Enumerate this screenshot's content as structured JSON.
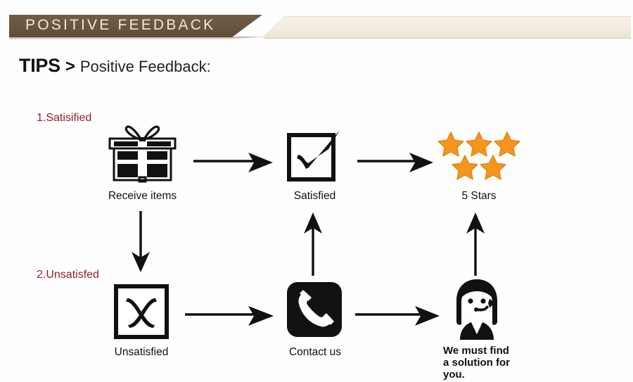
{
  "banner": {
    "title": "POSITIVE  FEEDBACK",
    "dark_color": "#6b573f",
    "light_color": "#f3ece0",
    "text_color": "#f3e7d2"
  },
  "tips": {
    "keyword": "TIPS",
    "separator": ">",
    "text": "Positive Feedback:"
  },
  "flow": {
    "label_color": "#8f1f2a",
    "star_color": "#f7941e",
    "steps": [
      {
        "number": "1.Satisified"
      },
      {
        "number": "2.Unsatisfed"
      }
    ],
    "nodes": [
      {
        "id": "receive-items",
        "icon": "gift-box-icon",
        "caption": "Receive items"
      },
      {
        "id": "satisfied",
        "icon": "check-box-icon",
        "caption": "Satisfied"
      },
      {
        "id": "five-stars",
        "icon": "five-stars-icon",
        "caption": "5 Stars"
      },
      {
        "id": "unsatisfied",
        "icon": "x-box-icon",
        "caption": "Unsatisfied"
      },
      {
        "id": "contact-us",
        "icon": "telephone-icon",
        "caption": "Contact us"
      },
      {
        "id": "agent",
        "icon": "support-agent-icon",
        "caption_lines": [
          "We must find",
          "a solution for",
          "you."
        ]
      }
    ],
    "arrows": [
      {
        "id": "receive-to-satisfied",
        "direction": "right"
      },
      {
        "id": "satisfied-to-stars",
        "direction": "right"
      },
      {
        "id": "receive-to-unsatisfied",
        "direction": "down"
      },
      {
        "id": "unsatisfied-to-contact",
        "direction": "right"
      },
      {
        "id": "contact-to-satisfied",
        "direction": "up"
      },
      {
        "id": "contact-to-agent",
        "direction": "right"
      },
      {
        "id": "agent-to-stars",
        "direction": "up"
      }
    ]
  },
  "captions": {
    "receive_items": "Receive items",
    "satisfied": "Satisfied",
    "five_stars": "5 Stars",
    "unsatisfied": "Unsatisfied",
    "contact_us": "Contact us",
    "agent_l1": "We must find",
    "agent_l2": "a solution for",
    "agent_l3": "you."
  }
}
